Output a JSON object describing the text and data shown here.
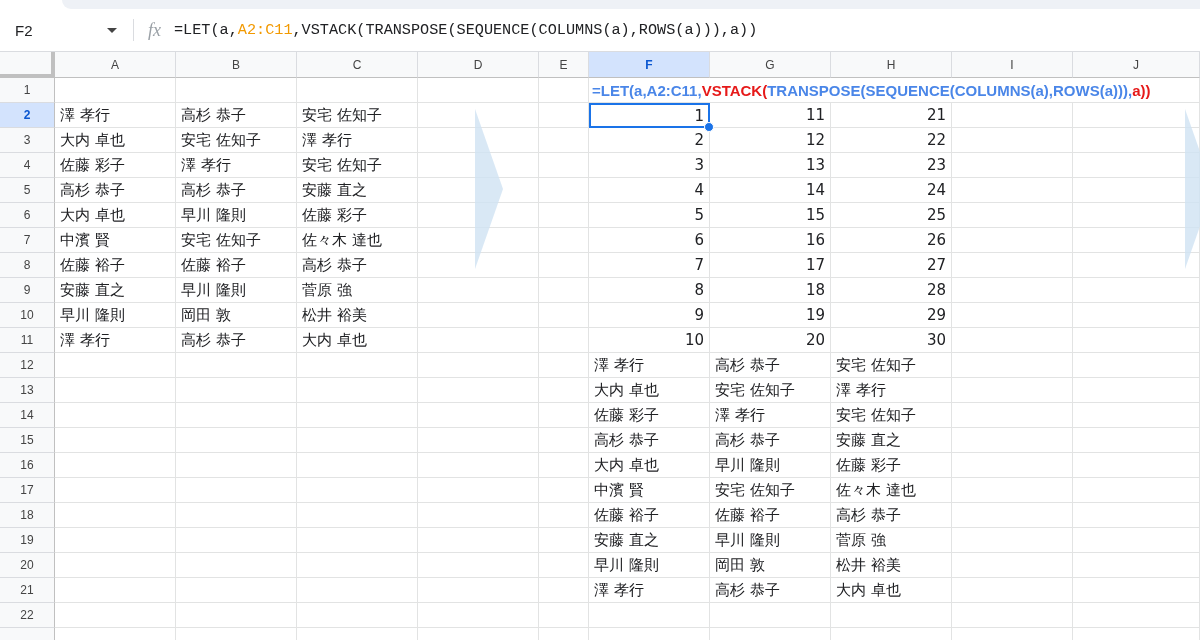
{
  "name_box": "F2",
  "fx_label": "fx",
  "formula_bar": [
    {
      "text": "=LET(a,",
      "color": "#202124"
    },
    {
      "text": "A2:C11",
      "color": "#f29900"
    },
    {
      "text": ",VSTACK(TRANSPOSE(SEQUENCE(COLUMNS(a),ROWS(a))),a))",
      "color": "#202124"
    }
  ],
  "columns": [
    {
      "label": "A",
      "selected": false
    },
    {
      "label": "B",
      "selected": false
    },
    {
      "label": "C",
      "selected": false
    },
    {
      "label": "D",
      "selected": false
    },
    {
      "label": "E",
      "selected": false
    },
    {
      "label": "F",
      "selected": true
    },
    {
      "label": "G",
      "selected": false
    },
    {
      "label": "H",
      "selected": false
    },
    {
      "label": "I",
      "selected": false
    },
    {
      "label": "J",
      "selected": false
    }
  ],
  "rows": [
    {
      "number": "1",
      "selected": false,
      "formula": [
        {
          "text": "=LET(a,A2:C11,",
          "color": "#4a86e8"
        },
        {
          "text": "VSTACK(",
          "color": "#e61919"
        },
        {
          "text": "TRANSPOSE(SEQUENCE(COLUMNS(a),ROWS(a))),",
          "color": "#4a86e8"
        },
        {
          "text": "a))",
          "color": "#e61919"
        }
      ]
    },
    {
      "number": "2",
      "selected": true,
      "left": [
        "澤 孝行",
        "高杉 恭子",
        "安宅 佐知子"
      ],
      "right": [
        {
          "text": "1",
          "kind": "number",
          "selected": true
        },
        {
          "text": "11",
          "kind": "number",
          "selected": false
        },
        {
          "text": "21",
          "kind": "number",
          "selected": false
        }
      ]
    },
    {
      "number": "3",
      "selected": false,
      "left": [
        "大内 卓也",
        "安宅 佐知子",
        "澤 孝行"
      ],
      "right": [
        {
          "text": "2",
          "kind": "number",
          "selected": false
        },
        {
          "text": "12",
          "kind": "number",
          "selected": false
        },
        {
          "text": "22",
          "kind": "number",
          "selected": false
        }
      ]
    },
    {
      "number": "4",
      "selected": false,
      "left": [
        "佐藤 彩子",
        "澤 孝行",
        "安宅 佐知子"
      ],
      "right": [
        {
          "text": "3",
          "kind": "number",
          "selected": false
        },
        {
          "text": "13",
          "kind": "number",
          "selected": false
        },
        {
          "text": "23",
          "kind": "number",
          "selected": false
        }
      ]
    },
    {
      "number": "5",
      "selected": false,
      "left": [
        "高杉 恭子",
        "高杉 恭子",
        "安藤 直之"
      ],
      "right": [
        {
          "text": "4",
          "kind": "number",
          "selected": false
        },
        {
          "text": "14",
          "kind": "number",
          "selected": false
        },
        {
          "text": "24",
          "kind": "number",
          "selected": false
        }
      ]
    },
    {
      "number": "6",
      "selected": false,
      "left": [
        "大内 卓也",
        "早川 隆則",
        "佐藤 彩子"
      ],
      "right": [
        {
          "text": "5",
          "kind": "number",
          "selected": false
        },
        {
          "text": "15",
          "kind": "number",
          "selected": false
        },
        {
          "text": "25",
          "kind": "number",
          "selected": false
        }
      ]
    },
    {
      "number": "7",
      "selected": false,
      "left": [
        "中濱 賢",
        "安宅 佐知子",
        "佐々木 達也"
      ],
      "right": [
        {
          "text": "6",
          "kind": "number",
          "selected": false
        },
        {
          "text": "16",
          "kind": "number",
          "selected": false
        },
        {
          "text": "26",
          "kind": "number",
          "selected": false
        }
      ]
    },
    {
      "number": "8",
      "selected": false,
      "left": [
        "佐藤 裕子",
        "佐藤 裕子",
        "高杉 恭子"
      ],
      "right": [
        {
          "text": "7",
          "kind": "number",
          "selected": false
        },
        {
          "text": "17",
          "kind": "number",
          "selected": false
        },
        {
          "text": "27",
          "kind": "number",
          "selected": false
        }
      ]
    },
    {
      "number": "9",
      "selected": false,
      "left": [
        "安藤 直之",
        "早川 隆則",
        "菅原 強"
      ],
      "right": [
        {
          "text": "8",
          "kind": "number",
          "selected": false
        },
        {
          "text": "18",
          "kind": "number",
          "selected": false
        },
        {
          "text": "28",
          "kind": "number",
          "selected": false
        }
      ]
    },
    {
      "number": "10",
      "selected": false,
      "left": [
        "早川 隆則",
        "岡田 敦",
        "松井 裕美"
      ],
      "right": [
        {
          "text": "9",
          "kind": "number",
          "selected": false
        },
        {
          "text": "19",
          "kind": "number",
          "selected": false
        },
        {
          "text": "29",
          "kind": "number",
          "selected": false
        }
      ]
    },
    {
      "number": "11",
      "selected": false,
      "left": [
        "澤 孝行",
        "高杉 恭子",
        "大内 卓也"
      ],
      "right": [
        {
          "text": "10",
          "kind": "number",
          "selected": false
        },
        {
          "text": "20",
          "kind": "number",
          "selected": false
        },
        {
          "text": "30",
          "kind": "number",
          "selected": false
        }
      ]
    },
    {
      "number": "12",
      "selected": false,
      "right": [
        {
          "text": "澤 孝行",
          "kind": "text",
          "selected": false
        },
        {
          "text": "高杉 恭子",
          "kind": "text",
          "selected": false
        },
        {
          "text": "安宅 佐知子",
          "kind": "text",
          "selected": false
        }
      ]
    },
    {
      "number": "13",
      "selected": false,
      "right": [
        {
          "text": "大内 卓也",
          "kind": "text",
          "selected": false
        },
        {
          "text": "安宅 佐知子",
          "kind": "text",
          "selected": false
        },
        {
          "text": "澤 孝行",
          "kind": "text",
          "selected": false
        }
      ]
    },
    {
      "number": "14",
      "selected": false,
      "right": [
        {
          "text": "佐藤 彩子",
          "kind": "text",
          "selected": false
        },
        {
          "text": "澤 孝行",
          "kind": "text",
          "selected": false
        },
        {
          "text": "安宅 佐知子",
          "kind": "text",
          "selected": false
        }
      ]
    },
    {
      "number": "15",
      "selected": false,
      "right": [
        {
          "text": "高杉 恭子",
          "kind": "text",
          "selected": false
        },
        {
          "text": "高杉 恭子",
          "kind": "text",
          "selected": false
        },
        {
          "text": "安藤 直之",
          "kind": "text",
          "selected": false
        }
      ]
    },
    {
      "number": "16",
      "selected": false,
      "right": [
        {
          "text": "大内 卓也",
          "kind": "text",
          "selected": false
        },
        {
          "text": "早川 隆則",
          "kind": "text",
          "selected": false
        },
        {
          "text": "佐藤 彩子",
          "kind": "text",
          "selected": false
        }
      ]
    },
    {
      "number": "17",
      "selected": false,
      "right": [
        {
          "text": "中濱 賢",
          "kind": "text",
          "selected": false
        },
        {
          "text": "安宅 佐知子",
          "kind": "text",
          "selected": false
        },
        {
          "text": "佐々木 達也",
          "kind": "text",
          "selected": false
        }
      ]
    },
    {
      "number": "18",
      "selected": false,
      "right": [
        {
          "text": "佐藤 裕子",
          "kind": "text",
          "selected": false
        },
        {
          "text": "佐藤 裕子",
          "kind": "text",
          "selected": false
        },
        {
          "text": "高杉 恭子",
          "kind": "text",
          "selected": false
        }
      ]
    },
    {
      "number": "19",
      "selected": false,
      "right": [
        {
          "text": "安藤 直之",
          "kind": "text",
          "selected": false
        },
        {
          "text": "早川 隆則",
          "kind": "text",
          "selected": false
        },
        {
          "text": "菅原 強",
          "kind": "text",
          "selected": false
        }
      ]
    },
    {
      "number": "20",
      "selected": false,
      "right": [
        {
          "text": "早川 隆則",
          "kind": "text",
          "selected": false
        },
        {
          "text": "岡田 敦",
          "kind": "text",
          "selected": false
        },
        {
          "text": "松井 裕美",
          "kind": "text",
          "selected": false
        }
      ]
    },
    {
      "number": "21",
      "selected": false,
      "right": [
        {
          "text": "澤 孝行",
          "kind": "text",
          "selected": false
        },
        {
          "text": "高杉 恭子",
          "kind": "text",
          "selected": false
        },
        {
          "text": "大内 卓也",
          "kind": "text",
          "selected": false
        }
      ]
    },
    {
      "number": "22",
      "selected": false
    }
  ]
}
